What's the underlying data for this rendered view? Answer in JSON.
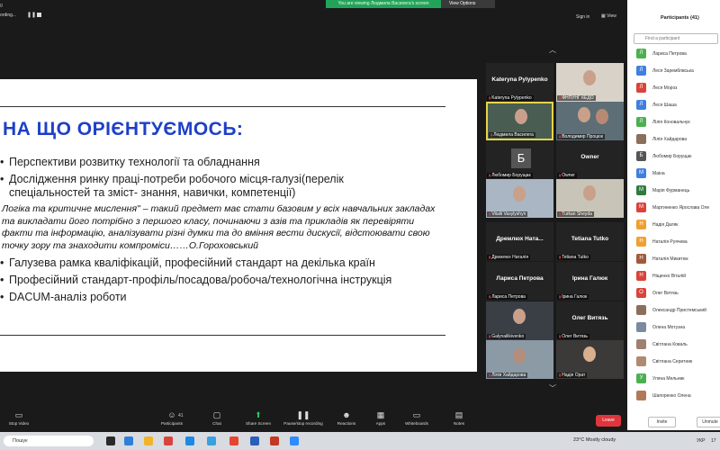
{
  "topbar": {
    "title_fragment": "g",
    "share_banner": "You are viewing Людмила Василега's screen",
    "view_options": "View Options",
    "recording_label": "ording...",
    "pause_icon": "pause-icon",
    "sign_in": "Sign in",
    "view": "View"
  },
  "slide": {
    "title": "НА ЩО ОРІЄНТУЄМОСЬ:",
    "bullets_top": [
      "Перспективи розвитку технології та обладнання",
      "Дослідження ринку праці-потреби робочого місця-галузі(перелік спеціальностей та зміст- знання, навички, компетенції)"
    ],
    "quote": "Логіка та критичне мислення\" – такий предмет має стати базовим у всіх навчальних закладах та викладати його потрібно з першого класу, починаючи з азів та прикладів як перевіряти факти та інформацію, аналізувати різні думки та до вміння вести дискусії, відстоювати свою точку зору та знаходити компроміси……О.Гороховський",
    "bullets_bottom": [
      "Галузева рамка кваліфікацій, професійний стандарт на декілька країн",
      "Професійний стандарт-профіль/посадова/робоча/технологічна інструкція",
      "DACUM-аналіз роботи"
    ]
  },
  "gallery": {
    "tiles": [
      {
        "name": "Kateryna  Pylypenko",
        "caption": "Kateryna Pylypenko"
      },
      {
        "name": "",
        "caption": "ФНПУНГ КЕДО"
      },
      {
        "name": "",
        "caption": "Людмила Василега"
      },
      {
        "name": "",
        "caption": "Володимир Процюк"
      },
      {
        "name": "",
        "letter": "Б",
        "caption": "Любомир Борущак"
      },
      {
        "name": "Owner",
        "caption": "Owner"
      },
      {
        "name": "",
        "caption": "Vitalii Vasylyshyn"
      },
      {
        "name": "",
        "caption": "Turkan Sheyda"
      },
      {
        "name": "Дремлюх  Ната...",
        "caption": "Дремлюх Наталія"
      },
      {
        "name": "Tetiana Tutko",
        "caption": "Tetiana Tutko"
      },
      {
        "name": "Лариса Петрова",
        "caption": "Лариса Петрова"
      },
      {
        "name": "Ірина Галюк",
        "caption": "Ірина Галюк"
      },
      {
        "name": "",
        "caption": "Galynailikivenko"
      },
      {
        "name": "Олег Витязь",
        "caption": "Олег Витязь"
      },
      {
        "name": "",
        "caption": "Лілія Хайдарова"
      },
      {
        "name": "",
        "caption": "Надія Орат"
      }
    ]
  },
  "participants": {
    "title": "Participants (41)",
    "search_placeholder": "Find a participant",
    "items": [
      {
        "initial": "Л",
        "color": "#4caf50",
        "name": "Лариса Петрова"
      },
      {
        "initial": "Л",
        "color": "#3f7fe0",
        "name": "Леся Заремблвська"
      },
      {
        "initial": "Л",
        "color": "#d9433a",
        "name": "Леся Мороз"
      },
      {
        "initial": "Л",
        "color": "#3f7fe0",
        "name": "Леся Шаша"
      },
      {
        "initial": "Л",
        "color": "#4caf50",
        "name": "Лілія Коновальчук"
      },
      {
        "initial": "",
        "color": "#8a6f5c",
        "name": "Лілія Хайдарова"
      },
      {
        "initial": "Б",
        "color": "#555555",
        "name": "Любомир Борущак"
      },
      {
        "initial": "М",
        "color": "#3f7fe0",
        "name": "Маіна"
      },
      {
        "initial": "М",
        "color": "#2f7a3e",
        "name": "Марія Фурманець"
      },
      {
        "initial": "М",
        "color": "#d9433a",
        "name": "Мартиненко Ярослава Оле"
      },
      {
        "initial": "Н",
        "color": "#f0a030",
        "name": "Надія Даляк"
      },
      {
        "initial": "Н",
        "color": "#f0a030",
        "name": "Наталія Руячева"
      },
      {
        "initial": "Н",
        "color": "#a05a3a",
        "name": "Наталія Микитюк"
      },
      {
        "initial": "Н",
        "color": "#d9433a",
        "name": "Ніщенко Віталій"
      },
      {
        "initial": "О",
        "color": "#d9433a",
        "name": "Олег Витязь"
      },
      {
        "initial": "",
        "color": "#8a6f5c",
        "name": "Олександр Пристемський"
      },
      {
        "initial": "",
        "color": "#7a8aa0",
        "name": "Олена Мотузна"
      },
      {
        "initial": "",
        "color": "#a08070",
        "name": "Світлана Коваль"
      },
      {
        "initial": "",
        "color": "#b08a70",
        "name": "Світлана Серитник"
      },
      {
        "initial": "У",
        "color": "#4caf50",
        "name": "Уляна Мельник"
      },
      {
        "initial": "",
        "color": "#b07a5a",
        "name": "Шапоренко Олена"
      }
    ],
    "invite": "Invite",
    "unmute": "Unmute"
  },
  "toolbar": {
    "items": [
      {
        "icon": "video-icon",
        "glyph": "▭",
        "label": "Stop Video"
      },
      {
        "icon": "participants-icon",
        "glyph": "☺",
        "label": "Participants"
      },
      {
        "icon": "chat-icon",
        "glyph": "▢",
        "label": "Chat"
      },
      {
        "icon": "share-screen-icon",
        "glyph": "⬆",
        "label": "Share Screen"
      },
      {
        "icon": "record-icon",
        "glyph": "❚❚",
        "label": "Pause/stop recording"
      },
      {
        "icon": "reactions-icon",
        "glyph": "☻",
        "label": "Reactions"
      },
      {
        "icon": "apps-icon",
        "glyph": "▦",
        "label": "Apps"
      },
      {
        "icon": "whiteboards-icon",
        "glyph": "▭",
        "label": "Whiteboards"
      },
      {
        "icon": "notes-icon",
        "glyph": "▤",
        "label": "Notes"
      }
    ],
    "participant_count": "41",
    "leave": "Leave"
  },
  "taskbar": {
    "search": "Пошук",
    "weather": "23°C  Mostly cloudy",
    "lang": "УКР",
    "clock": "17"
  }
}
